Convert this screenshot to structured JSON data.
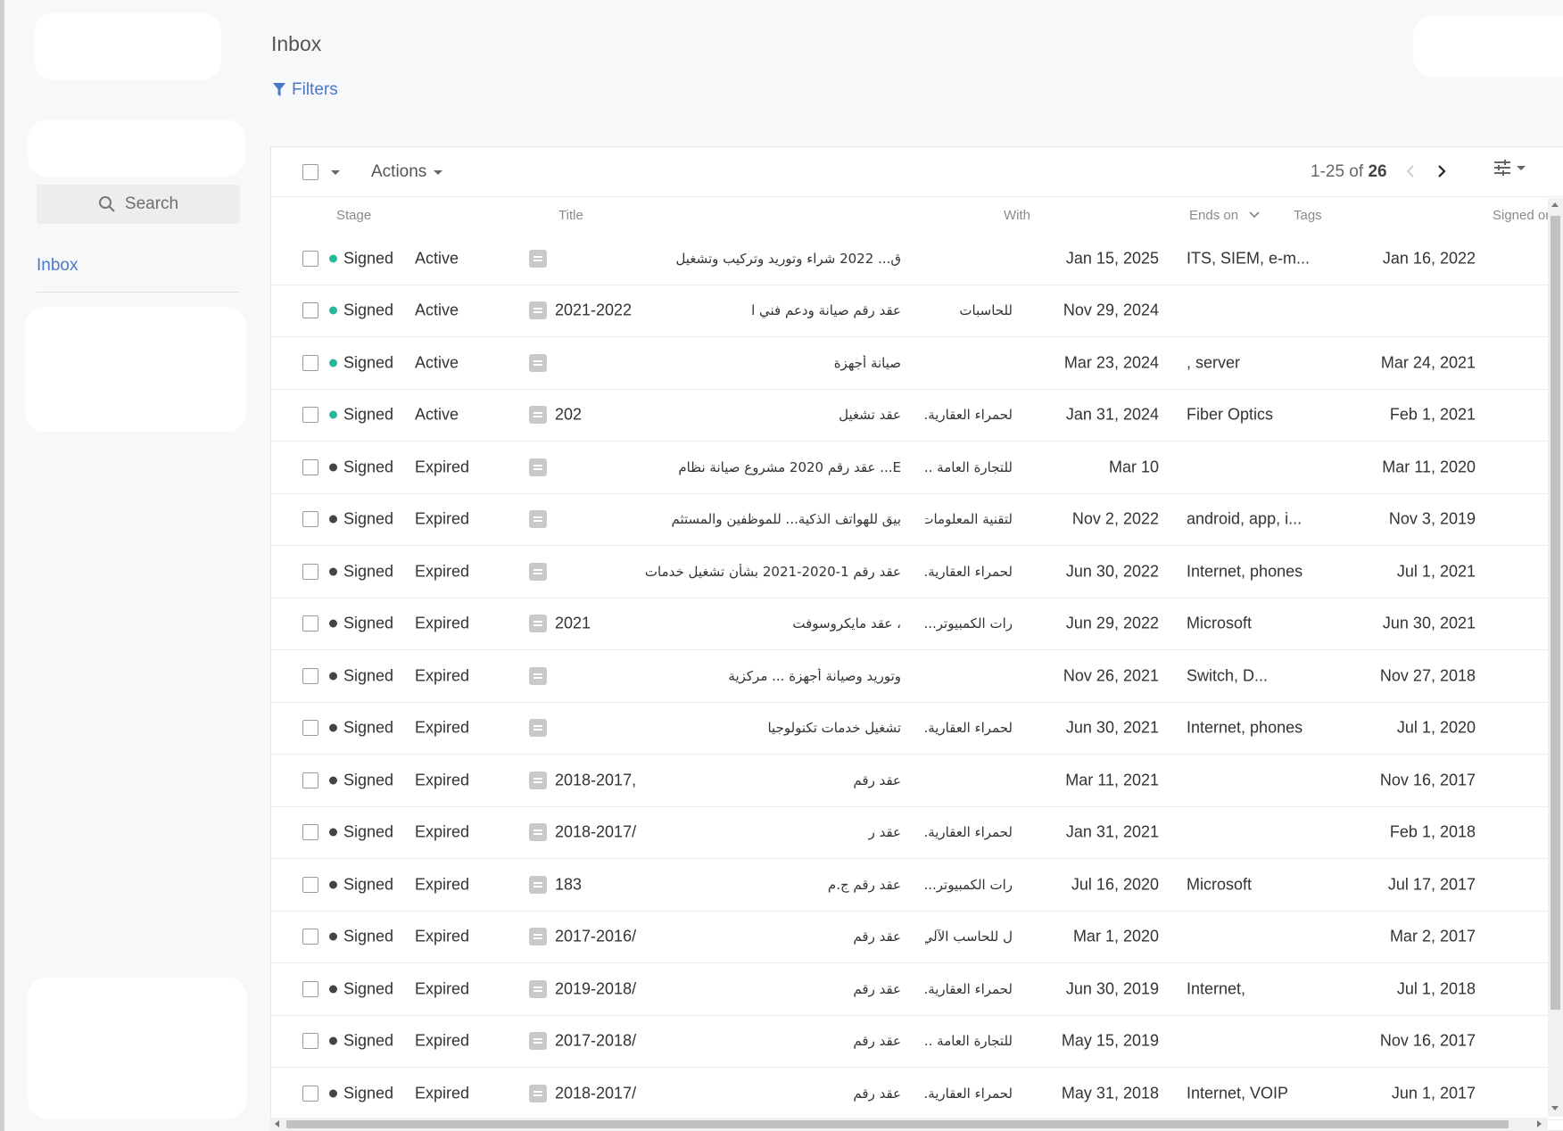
{
  "page": {
    "title": "Inbox"
  },
  "sidebar": {
    "search_label": "Search",
    "inbox_label": "Inbox"
  },
  "filters_label": "Filters",
  "toolbar": {
    "actions_label": "Actions",
    "range": "1-25 of ",
    "total": "26"
  },
  "columns": {
    "stage": "Stage",
    "title": "Title",
    "with": "With",
    "ends_on": "Ends on",
    "tags": "Tags",
    "signed_on": "Signed on"
  },
  "colors": {
    "active_dot": "#26b99a",
    "expired_dot": "#444444",
    "link": "#4a78c8"
  },
  "rows": [
    {
      "stage": "Signed",
      "status": "Active",
      "title_ltr": "",
      "title_rtl": "ق...                2022 شراء وتوريد وتركيب وتشغيل",
      "with": "",
      "ends": "Jan 15, 2025",
      "tags": "ITS, SIEM, e-m...",
      "signed": "Jan 16, 2022"
    },
    {
      "stage": "Signed",
      "status": "Active",
      "title_ltr": "2021-2022",
      "title_rtl": "عقد رقم صيانة ودعم فني ا",
      "with": "للحاسبات",
      "ends": "Nov 29, 2024",
      "tags": "",
      "signed": ""
    },
    {
      "stage": "Signed",
      "status": "Active",
      "title_ltr": "",
      "title_rtl": "صيانة أجهزة",
      "with": "",
      "ends": "Mar 23, 2024",
      "tags": ", server",
      "signed": "Mar 24, 2021"
    },
    {
      "stage": "Signed",
      "status": "Active",
      "title_ltr": "202",
      "title_rtl": "عقد تشغيل",
      "with": "لحمراء العقارية...",
      "ends": "Jan 31, 2024",
      "tags": "Fiber Optics",
      "signed": "Feb 1, 2021"
    },
    {
      "stage": "Signed",
      "status": "Expired",
      "title_ltr": "",
      "title_rtl": "E... عقد رقم          2020 مشروع صيانة نظام",
      "with": "للتجارة العامة ...",
      "ends": "Mar 10",
      "tags": "",
      "signed": "Mar 11, 2020"
    },
    {
      "stage": "Signed",
      "status": "Expired",
      "title_ltr": "",
      "title_rtl": "بيق للهواتف الذكية...                      للموظفين والمستثم",
      "with": "لتقنية المعلومات...",
      "ends": "Nov 2, 2022",
      "tags": "android, app, i...",
      "signed": "Nov 3, 2019"
    },
    {
      "stage": "Signed",
      "status": "Expired",
      "title_ltr": "",
      "title_rtl": "عقد رقم 1-2020-2021 بشأن تشغيل خدمات",
      "with": "لحمراء العقارية...",
      "ends": "Jun 30, 2022",
      "tags": "Internet, phones",
      "signed": "Jul 1, 2021"
    },
    {
      "stage": "Signed",
      "status": "Expired",
      "title_ltr": "2021",
      "title_rtl": "، عقد مايكروسوفت",
      "with": "رات الكمبيوتر...",
      "ends": "Jun 29, 2022",
      "tags": "Microsoft",
      "signed": "Jun 30, 2021"
    },
    {
      "stage": "Signed",
      "status": "Expired",
      "title_ltr": "",
      "title_rtl": "وتوريد وصيانة أجهزة ...                       مركزية",
      "with": "",
      "ends": "Nov 26, 2021",
      "tags": "Switch, D...",
      "signed": "Nov 27, 2018"
    },
    {
      "stage": "Signed",
      "status": "Expired",
      "title_ltr": "",
      "title_rtl": "تشغيل خدمات تكنولوجيا",
      "with": "لحمراء العقارية...",
      "ends": "Jun 30, 2021",
      "tags": "Internet, phones",
      "signed": "Jul 1, 2020"
    },
    {
      "stage": "Signed",
      "status": "Expired",
      "title_ltr": "2018-2017,",
      "title_rtl": "عقد رقم",
      "with": "",
      "ends": "Mar 11, 2021",
      "tags": "",
      "signed": "Nov 16, 2017"
    },
    {
      "stage": "Signed",
      "status": "Expired",
      "title_ltr": "2018-2017/",
      "title_rtl": "عقد ر",
      "with": "لحمراء العقارية...",
      "ends": "Jan 31, 2021",
      "tags": "",
      "signed": "Feb 1, 2018"
    },
    {
      "stage": "Signed",
      "status": "Expired",
      "title_ltr": "183",
      "title_rtl": "عقد رقم ج.م",
      "with": "رات الكمبيوتر...",
      "ends": "Jul 16, 2020",
      "tags": "Microsoft",
      "signed": "Jul 17, 2017"
    },
    {
      "stage": "Signed",
      "status": "Expired",
      "title_ltr": "2017-2016/",
      "title_rtl": "عقد رقم",
      "with": "ل للحاسب الآلي...",
      "ends": "Mar 1, 2020",
      "tags": "",
      "signed": "Mar 2, 2017"
    },
    {
      "stage": "Signed",
      "status": "Expired",
      "title_ltr": "2019-2018/",
      "title_rtl": "عقد رقم",
      "with": "لحمراء العقارية...",
      "ends": "Jun 30, 2019",
      "tags": "Internet,",
      "signed": "Jul 1, 2018"
    },
    {
      "stage": "Signed",
      "status": "Expired",
      "title_ltr": "2017-2018/",
      "title_rtl": "عقد رقم",
      "with": "للتجارة العامة ...",
      "ends": "May 15, 2019",
      "tags": "",
      "signed": "Nov 16, 2017"
    },
    {
      "stage": "Signed",
      "status": "Expired",
      "title_ltr": "2018-2017/",
      "title_rtl": "عقد رقم",
      "with": "لحمراء العقارية...",
      "ends": "May 31, 2018",
      "tags": "Internet, VOIP",
      "signed": "Jun 1, 2017"
    }
  ]
}
